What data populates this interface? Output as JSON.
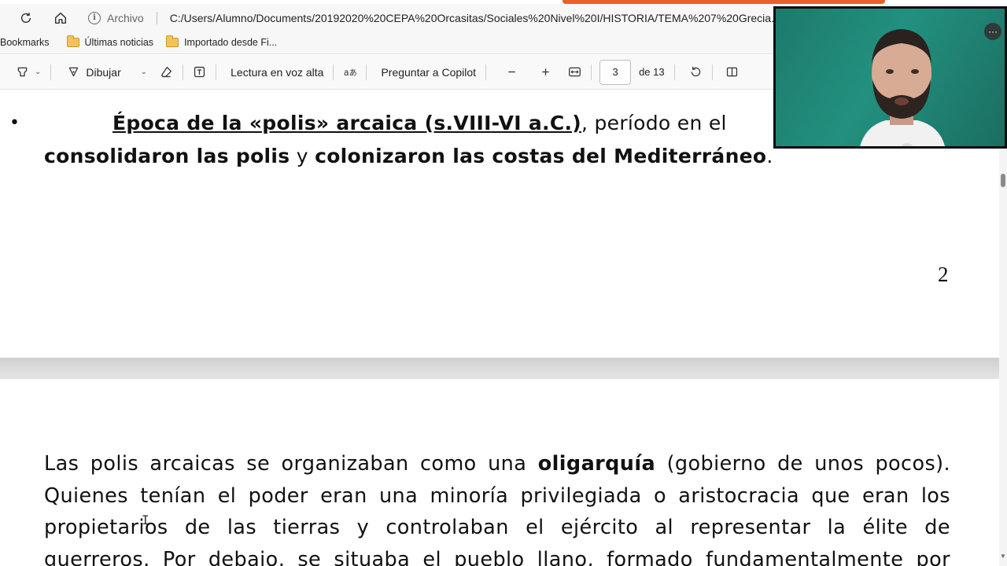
{
  "browser": {
    "url_prefix": "Archivo",
    "url": "C:/Users/Alumno/Documents/20192020%20CEPA%20Orcasitas/Sociales%20Nivel%20I/HISTORIA/TEMA%207%20Grecia...."
  },
  "bookmarks": {
    "label": "Bookmarks",
    "items": [
      "Últimas noticias",
      "Importado desde Fi..."
    ]
  },
  "toolbar": {
    "draw_label": "Dibujar",
    "read_aloud_label": "Lectura en voz alta",
    "copilot_label": "Preguntar a Copilot",
    "current_page": "3",
    "total_pages": "de 13"
  },
  "document": {
    "bullet": "•",
    "heading_underlined": "Época de la «polis» arcaica ",
    "heading_dates": "(s.VIII-VI a.C.)",
    "heading_rest": ", período en el",
    "line2_part1": "consolidaron las polis",
    "line2_y": " y ",
    "line2_part2": "colonizaron las costas del Mediterráneo",
    "line2_end": ".",
    "page_number": "2",
    "para_lines": [
      [
        "Las polis arcaicas se organizaban como una ",
        "oligarquía",
        " (gobierno de unos pocos)."
      ],
      [
        "Quienes tenían el poder eran una minoría privilegiada o aristocracia que eran los"
      ],
      [
        "propietarios de las tierras y controlaban el ejército al representar la élite de"
      ],
      [
        "guerreros. Por debajo, se situaba el pueblo llano, formado fundamentalmente por"
      ]
    ]
  },
  "webcam": {
    "more_label": "···"
  }
}
